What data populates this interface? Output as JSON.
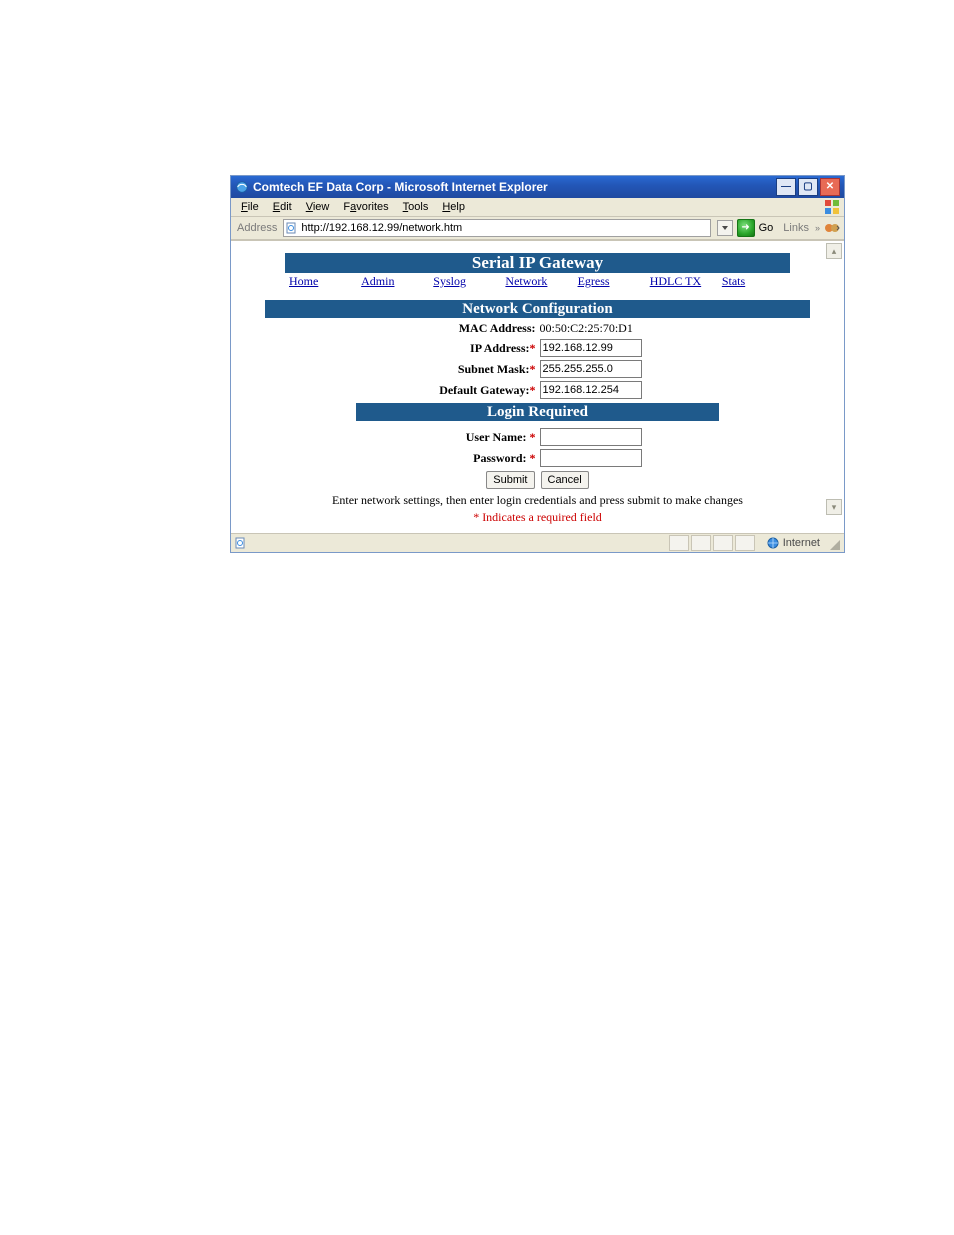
{
  "window": {
    "title": "Comtech EF Data Corp - Microsoft Internet Explorer"
  },
  "menubar": {
    "file": "File",
    "edit": "Edit",
    "view": "View",
    "favorites": "Favorites",
    "tools": "Tools",
    "help": "Help"
  },
  "addressbar": {
    "label": "Address",
    "url": "http://192.168.12.99/network.htm",
    "go": "Go",
    "links": "Links"
  },
  "page": {
    "title_banner": "Serial IP Gateway",
    "tabs": {
      "home": "Home",
      "admin": "Admin",
      "syslog": "Syslog",
      "network": "Network",
      "egress": "Egress",
      "hdlctx": "HDLC TX",
      "stats": "Stats"
    },
    "section_banner": "Network Configuration",
    "mac": {
      "label": "MAC Address:",
      "value": "00:50:C2:25:70:D1"
    },
    "ip": {
      "label": "IP Address:",
      "value": "192.168.12.99"
    },
    "mask": {
      "label": "Subnet Mask:",
      "value": "255.255.255.0"
    },
    "gw": {
      "label": "Default Gateway:",
      "value": "192.168.12.254"
    },
    "login_banner": "Login Required",
    "user": {
      "label": "User Name:",
      "value": ""
    },
    "pass": {
      "label": "Password:",
      "value": ""
    },
    "submit": "Submit",
    "cancel": "Cancel",
    "note": "Enter network settings, then enter login credentials and press submit to make changes",
    "note2": "* Indicates a required field",
    "asterisk": "*"
  },
  "statusbar": {
    "zone": "Internet"
  }
}
